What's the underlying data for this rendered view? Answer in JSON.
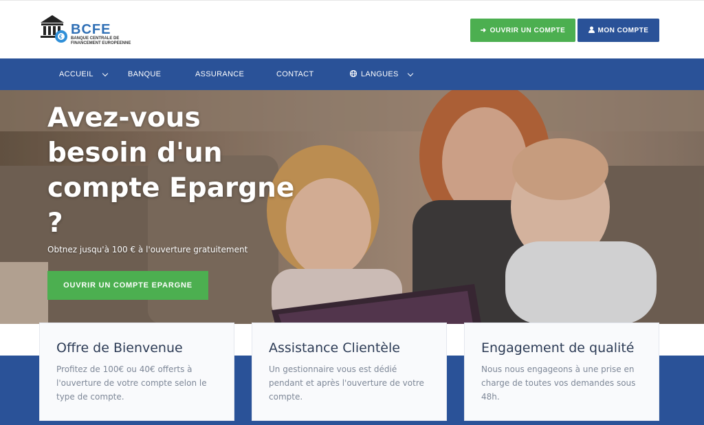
{
  "brand": {
    "name": "BCFE",
    "subtitle": "BANQUE CENTRALE DE FINANCEMENT EUROPEENNE"
  },
  "header": {
    "open_account_label": "OUVRIR UN COMPTE",
    "my_account_label": "MON COMPTE"
  },
  "nav": {
    "items": [
      {
        "label": "ACCUEIL",
        "has_dropdown": true
      },
      {
        "label": "BANQUE",
        "has_dropdown": false
      },
      {
        "label": "ASSURANCE",
        "has_dropdown": false
      },
      {
        "label": "CONTACT",
        "has_dropdown": false
      },
      {
        "label": "LANGUES",
        "has_dropdown": true,
        "icon": "globe-icon"
      }
    ]
  },
  "hero": {
    "title": "Avez-vous besoin d'un compte Epargne ?",
    "subtitle": "Obtnez jusqu'à 100 € à l'ouverture gratuitement",
    "cta_label": "OUVRIR UN COMPTE EPARGNE"
  },
  "cards": [
    {
      "title": "Offre de Bienvenue",
      "text": "Profitez de 100€ ou 40€ offerts à l'ouverture de votre compte selon le type de compte."
    },
    {
      "title": "Assistance Clientèle",
      "text": "Un gestionnaire vous est dédié pendant et après l'ouverture de votre compte."
    },
    {
      "title": "Engagement de qualité",
      "text": "Nous nous engageons à une prise en charge de toutes vos demandes sous 48h."
    }
  ],
  "colors": {
    "primary_blue": "#2a5298",
    "accent_green": "#4caf50",
    "card_title": "#2c3b55",
    "card_text": "#7d8797"
  }
}
